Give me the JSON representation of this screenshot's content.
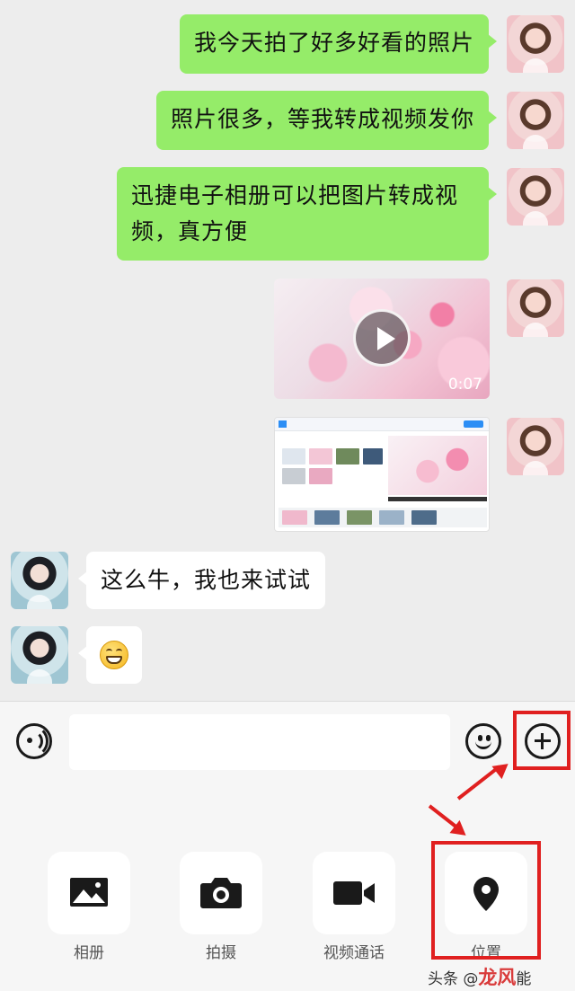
{
  "messages": [
    {
      "from": "me",
      "type": "text",
      "text": "我今天拍了好多好看的照片"
    },
    {
      "from": "me",
      "type": "text",
      "text": "照片很多，等我转成视频发你"
    },
    {
      "from": "me",
      "type": "text",
      "text": "迅捷电子相册可以把图片转成视频，真方便"
    },
    {
      "from": "me",
      "type": "video",
      "duration": "0:07"
    },
    {
      "from": "me",
      "type": "image",
      "description": "screenshot"
    },
    {
      "from": "them",
      "type": "text",
      "text": "这么牛，我也来试试"
    },
    {
      "from": "them",
      "type": "emoji",
      "emoji": "grinning-face"
    }
  ],
  "input_bar": {
    "voice_icon": "voice-icon",
    "input_value": "",
    "emoji_icon": "smile-icon",
    "more_icon": "plus-icon",
    "highlighted": "more-button"
  },
  "panel": {
    "tools": [
      {
        "label": "相册",
        "icon": "image-icon"
      },
      {
        "label": "拍摄",
        "icon": "camera-icon"
      },
      {
        "label": "视频通话",
        "icon": "video-camera-icon"
      },
      {
        "label": "位置",
        "icon": "location-pin-icon",
        "highlighted": true
      }
    ]
  },
  "annotation_color": "#e02020",
  "watermark": {
    "prefix": "头条 @",
    "accent": "龙风",
    "suffix": "能"
  },
  "colors": {
    "my_bubble": "#95ec69",
    "their_bubble": "#ffffff",
    "background": "#ededed"
  }
}
